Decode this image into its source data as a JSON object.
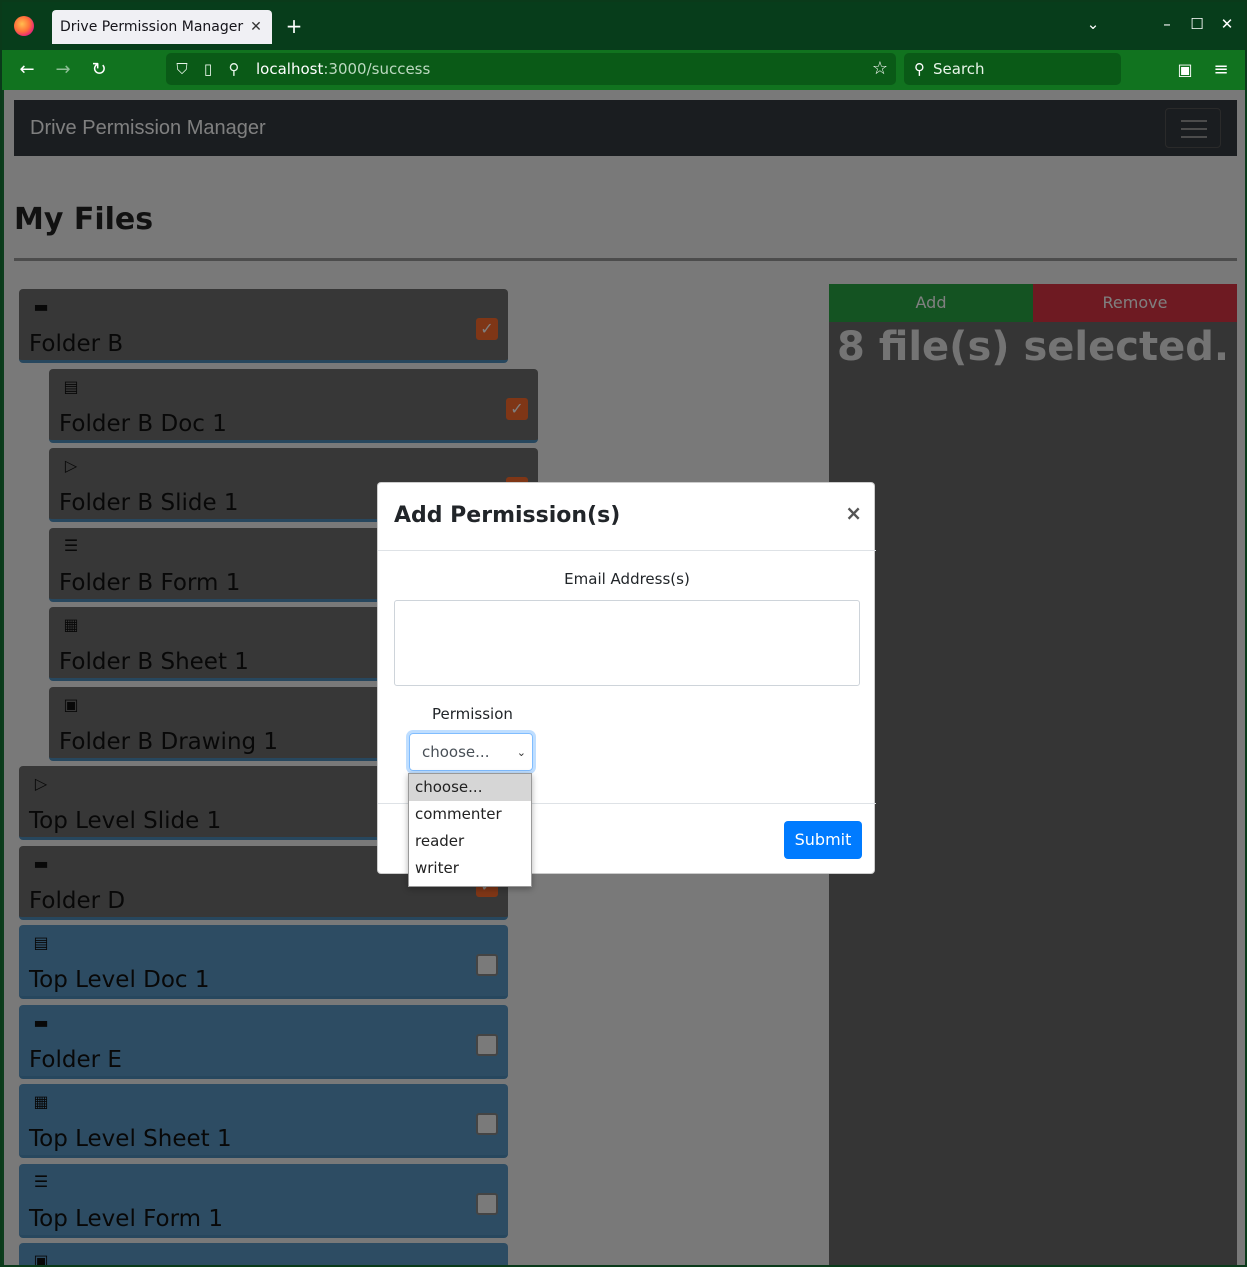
{
  "browser": {
    "tab_title": "Drive Permission Manager",
    "tab_close": "✕",
    "new_tab": "+",
    "url_host": "localhost",
    "url_path": ":3000/success",
    "search_placeholder": "Search"
  },
  "app": {
    "brand": "Drive Permission Manager",
    "page_title": "My Files"
  },
  "files": [
    {
      "name": "Folder B",
      "icon": "folder-icon",
      "glyph": "▬",
      "checked": true
    },
    {
      "name": "Folder B Doc 1",
      "icon": "document-icon",
      "glyph": "▤",
      "checked": true
    },
    {
      "name": "Folder B Slide 1",
      "icon": "slides-icon",
      "glyph": "▷",
      "checked": true
    },
    {
      "name": "Folder B Form 1",
      "icon": "form-icon",
      "glyph": "☰",
      "checked": true
    },
    {
      "name": "Folder B Sheet 1",
      "icon": "sheet-icon",
      "glyph": "▦",
      "checked": true
    },
    {
      "name": "Folder B Drawing 1",
      "icon": "image-icon",
      "glyph": "▣",
      "checked": true
    },
    {
      "name": "Top Level Slide 1",
      "icon": "slides-icon",
      "glyph": "▷",
      "checked": true
    },
    {
      "name": "Folder D",
      "icon": "folder-icon",
      "glyph": "▬",
      "checked": true
    },
    {
      "name": "Top Level Doc 1",
      "icon": "document-icon",
      "glyph": "▤",
      "checked": false
    },
    {
      "name": "Folder E",
      "icon": "folder-icon",
      "glyph": "▬",
      "checked": false
    },
    {
      "name": "Top Level Sheet 1",
      "icon": "sheet-icon",
      "glyph": "▦",
      "checked": false
    },
    {
      "name": "Top Level Form 1",
      "icon": "form-icon",
      "glyph": "☰",
      "checked": false
    },
    {
      "name": "",
      "icon": "image-icon",
      "glyph": "▣",
      "checked": false
    }
  ],
  "side_panel": {
    "add_label": "Add",
    "remove_label": "Remove",
    "selected_text": "8 file(s) selected."
  },
  "modal": {
    "title": "Add Permission(s)",
    "close": "×",
    "email_label": "Email Address(s)",
    "email_value": "",
    "permission_label": "Permission",
    "permission_selected": "choose...",
    "permission_options": [
      "choose...",
      "commenter",
      "reader",
      "writer"
    ],
    "submit_label": "Submit"
  },
  "colors": {
    "browser_frame": "#073d1b",
    "navbar": "#11731f",
    "file_item": "#5b99c7",
    "checkbox_checked": "#ff6c2c",
    "add": "#28a745",
    "remove": "#dc3545",
    "submit": "#007bff"
  }
}
